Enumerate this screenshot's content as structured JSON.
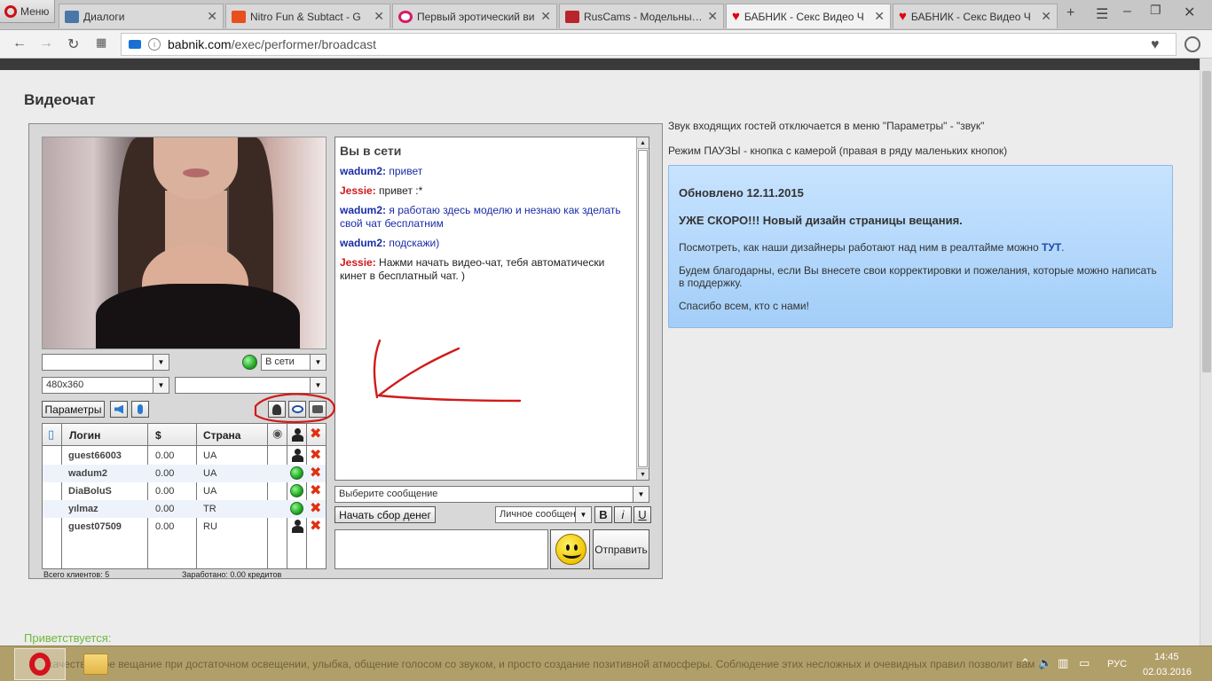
{
  "browser": {
    "menu_label": "Меню",
    "tabs": [
      {
        "title": "Диалоги",
        "icon": "vk-icon"
      },
      {
        "title": "Nitro Fun & Subtact - G",
        "icon": "soundcloud-icon"
      },
      {
        "title": "Первый эротический ви",
        "icon": "site-ring-icon"
      },
      {
        "title": "RusCams - Модельный к",
        "icon": "ruscams-icon"
      },
      {
        "title": "БАБНИК - Секс Видео Ч",
        "icon": "heart-icon"
      },
      {
        "title": "БАБНИК - Секс Видео Ч",
        "icon": "heart-icon"
      }
    ],
    "url_host": "babnik.com",
    "url_path": "/exec/performer/broadcast"
  },
  "page": {
    "title": "Видеочат",
    "welcome": "Приветствуется:",
    "welcome_text": "качественное вещание при достаточном освещении, улыбка, общение голосом со звуком, и просто создание позитивной атмосферы. Соблюдение этих несложных и очевидных правил позволит вам"
  },
  "app": {
    "status_value": "В сети",
    "resolution": "480x360",
    "params_label": "Параметры",
    "columns": [
      "Логин",
      "$",
      "Страна"
    ],
    "users": [
      {
        "login": "guest66003",
        "amount": "0.00",
        "country": "UA",
        "status": "user"
      },
      {
        "login": "wadum2",
        "amount": "0.00",
        "country": "UA",
        "status": "online"
      },
      {
        "login": "DiaBoluS",
        "amount": "0.00",
        "country": "UA",
        "status": "online"
      },
      {
        "login": "yılmaz",
        "amount": "0.00",
        "country": "TR",
        "status": "online"
      },
      {
        "login": "guest07509",
        "amount": "0.00",
        "country": "RU",
        "status": "user"
      }
    ],
    "total_clients": "Всего клиентов: 5",
    "earned": "Заработано: 0.00 кредитов",
    "chat": {
      "title": "Вы в сети",
      "messages": [
        {
          "nick": "wadum2:",
          "text": "привет",
          "color": "blue"
        },
        {
          "nick": "Jessie:",
          "text": "привет :*",
          "color": "red"
        },
        {
          "nick": "wadum2:",
          "text": "я работаю здесь моделю и незнаю как зделать свой чат бесплатним",
          "color": "blue"
        },
        {
          "nick": "wadum2:",
          "text": "подскажи)",
          "color": "blue"
        },
        {
          "nick": "Jessie:",
          "text": "Нажми начать видео-чат, тебя автоматически кинет в бесплатный чат. )",
          "color": "red"
        }
      ]
    },
    "select_message": "Выберите сообщение",
    "collect_money": "Начать сбор денег",
    "private_msg": "Личное сообщение",
    "bold": "B",
    "italic": "i",
    "underline": "U",
    "send": "Отправить"
  },
  "info": {
    "line1": "Звук входящих гостей отключается в меню \"Параметры\" - \"звук\"",
    "line2": "Режим ПАУЗЫ - кнопка с камерой (правая в ряду маленьких кнопок)",
    "notice_date": "Обновлено 12.11.2015",
    "notice_head": "УЖЕ СКОРО!!! Новый дизайн страницы вещания.",
    "notice_p1": "Посмотреть, как наши дизайнеры работают над ним в реалтайме можно",
    "notice_link": "ТУТ",
    "notice_p2": "Будем благодарны, если Вы внесете свои корректировки и пожелания, которые можно написать в поддержку.",
    "notice_p3": "Спасибо всем, кто с нами!"
  },
  "taskbar": {
    "lang": "РУС",
    "time": "14:45",
    "date": "02.03.2016"
  }
}
